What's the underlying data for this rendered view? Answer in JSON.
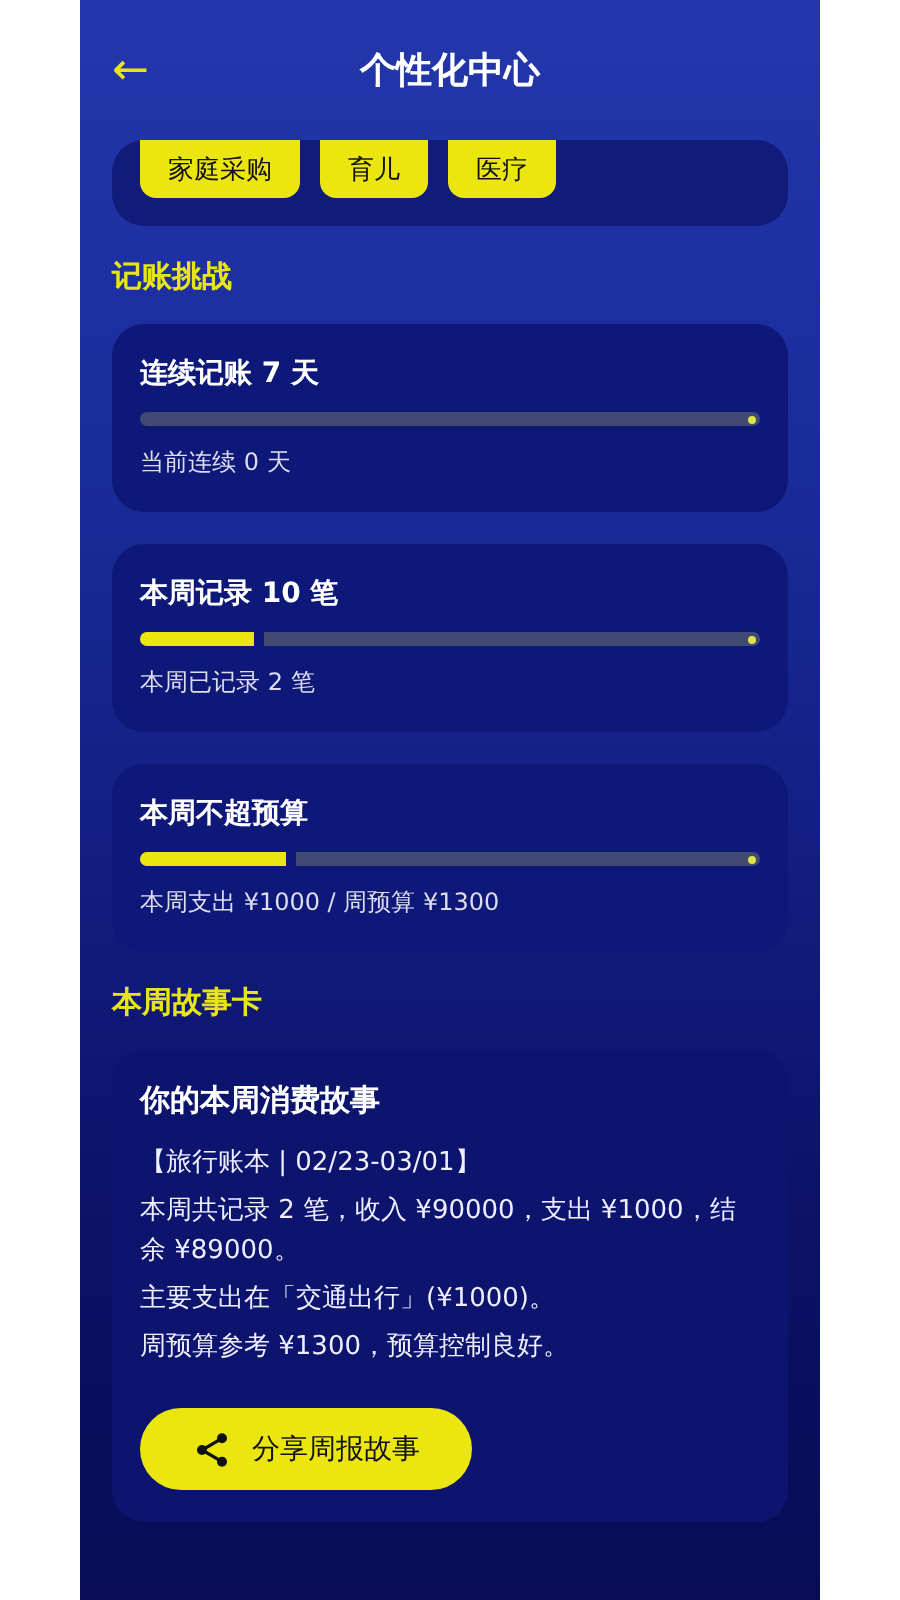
{
  "header": {
    "back_icon": "←",
    "title": "个性化中心"
  },
  "tags": [
    {
      "label": "家庭采购"
    },
    {
      "label": "育儿"
    },
    {
      "label": "医疗"
    }
  ],
  "challenges_heading": "记账挑战",
  "challenges": [
    {
      "title": "连续记账 7 天",
      "level": 0,
      "note": "当前连续 0 天"
    },
    {
      "title": "本周记录 10 笔",
      "level": 0.2,
      "note": "本周已记录 2 笔"
    },
    {
      "title": "本周不超预算",
      "level": 0.25,
      "note": "本周支出 ¥1000 / 周预算 ¥1300"
    }
  ],
  "story_heading": "本周故事卡",
  "story": {
    "title": "你的本周消费故事",
    "lines": [
      "【旅行账本 | 02/23-03/01】",
      "本周共记录 2 笔，收入 ¥90000，支出 ¥1000，结余 ¥89000。",
      "主要支出在「交通出行」(¥1000)。",
      "周预算参考 ¥1300，预算控制良好。"
    ],
    "button": "分享周报故事"
  }
}
